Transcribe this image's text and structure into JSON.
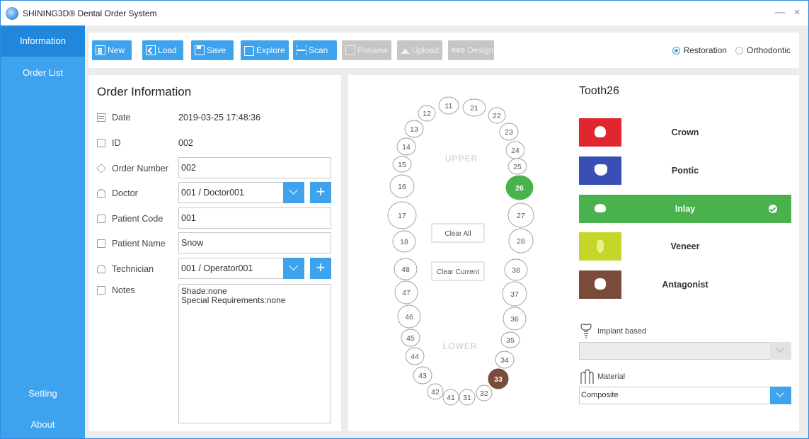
{
  "window": {
    "title": "SHINING3D® Dental Order System",
    "minimize_glyph": "—",
    "close_glyph": "×"
  },
  "sidebar": {
    "items": [
      {
        "label": "Information",
        "active": true
      },
      {
        "label": "Order List",
        "active": false
      },
      {
        "label": "Setting",
        "active": false
      },
      {
        "label": "About",
        "active": false
      }
    ]
  },
  "toolbar": {
    "buttons": [
      {
        "label": "New",
        "icon": "new-file-icon",
        "enabled": true
      },
      {
        "label": "Load",
        "icon": "load-icon",
        "enabled": true
      },
      {
        "label": "Save",
        "icon": "save-icon",
        "enabled": true
      },
      {
        "label": "Explore",
        "icon": "folder-icon",
        "enabled": true
      },
      {
        "label": "Scan",
        "icon": "scan-icon",
        "enabled": true
      },
      {
        "label": "Preview",
        "icon": "preview-icon",
        "enabled": false
      },
      {
        "label": "Upload",
        "icon": "upload-icon",
        "enabled": false
      },
      {
        "label": "Design",
        "prefix": "exo",
        "enabled": false
      }
    ],
    "mode": {
      "options": [
        "Restoration",
        "Orthodontic"
      ],
      "selected": "Restoration"
    }
  },
  "order_info": {
    "title": "Order Information",
    "fields": {
      "date": {
        "label": "Date",
        "value": "2019-03-25 17:48:36"
      },
      "id": {
        "label": "ID",
        "value": "002"
      },
      "order_number": {
        "label": "Order Number",
        "value": "002"
      },
      "doctor": {
        "label": "Doctor",
        "value": "001 / Doctor001"
      },
      "patient_code": {
        "label": "Patient Code",
        "value": "001"
      },
      "patient_name": {
        "label": "Patient Name",
        "value": "Snow"
      },
      "technician": {
        "label": "Technician",
        "value": "001 / Operator001"
      },
      "notes": {
        "label": "Notes",
        "lines": [
          "Shade:none",
          "Special Requirements:none"
        ]
      }
    },
    "add_glyph": "+"
  },
  "tooth_chart": {
    "upper_label": "UPPER",
    "lower_label": "LOWER",
    "clear_all": "Clear All",
    "clear_current": "Clear Current",
    "teeth": [
      {
        "num": "11",
        "state": "none"
      },
      {
        "num": "12",
        "state": "none"
      },
      {
        "num": "13",
        "state": "none"
      },
      {
        "num": "14",
        "state": "none"
      },
      {
        "num": "15",
        "state": "none"
      },
      {
        "num": "16",
        "state": "none"
      },
      {
        "num": "17",
        "state": "none"
      },
      {
        "num": "18",
        "state": "none"
      },
      {
        "num": "21",
        "state": "none"
      },
      {
        "num": "22",
        "state": "none"
      },
      {
        "num": "23",
        "state": "none"
      },
      {
        "num": "24",
        "state": "none"
      },
      {
        "num": "25",
        "state": "none"
      },
      {
        "num": "26",
        "state": "inlay"
      },
      {
        "num": "27",
        "state": "none"
      },
      {
        "num": "28",
        "state": "none"
      },
      {
        "num": "31",
        "state": "none"
      },
      {
        "num": "32",
        "state": "none"
      },
      {
        "num": "33",
        "state": "antagonist"
      },
      {
        "num": "34",
        "state": "none"
      },
      {
        "num": "35",
        "state": "none"
      },
      {
        "num": "36",
        "state": "none"
      },
      {
        "num": "37",
        "state": "none"
      },
      {
        "num": "38",
        "state": "none"
      },
      {
        "num": "41",
        "state": "none"
      },
      {
        "num": "42",
        "state": "none"
      },
      {
        "num": "43",
        "state": "none"
      },
      {
        "num": "44",
        "state": "none"
      },
      {
        "num": "45",
        "state": "none"
      },
      {
        "num": "46",
        "state": "none"
      },
      {
        "num": "47",
        "state": "none"
      },
      {
        "num": "48",
        "state": "none"
      }
    ],
    "state_colors": {
      "inlay": "#4ab24c",
      "antagonist": "#7a4a3a"
    }
  },
  "restoration": {
    "title": "Tooth26",
    "types": [
      {
        "label": "Crown",
        "color": "#e0262f",
        "selected": false
      },
      {
        "label": "Pontic",
        "color": "#3a4fb5",
        "selected": false
      },
      {
        "label": "Inlay",
        "color": "#4ab24c",
        "selected": true
      },
      {
        "label": "Veneer",
        "color": "#c5d62a",
        "selected": false
      },
      {
        "label": "Antagonist",
        "color": "#7a4a3a",
        "selected": false
      }
    ],
    "implant_label": "Implant based",
    "implant_value": "",
    "material_label": "Material",
    "material_value": "Composite"
  }
}
